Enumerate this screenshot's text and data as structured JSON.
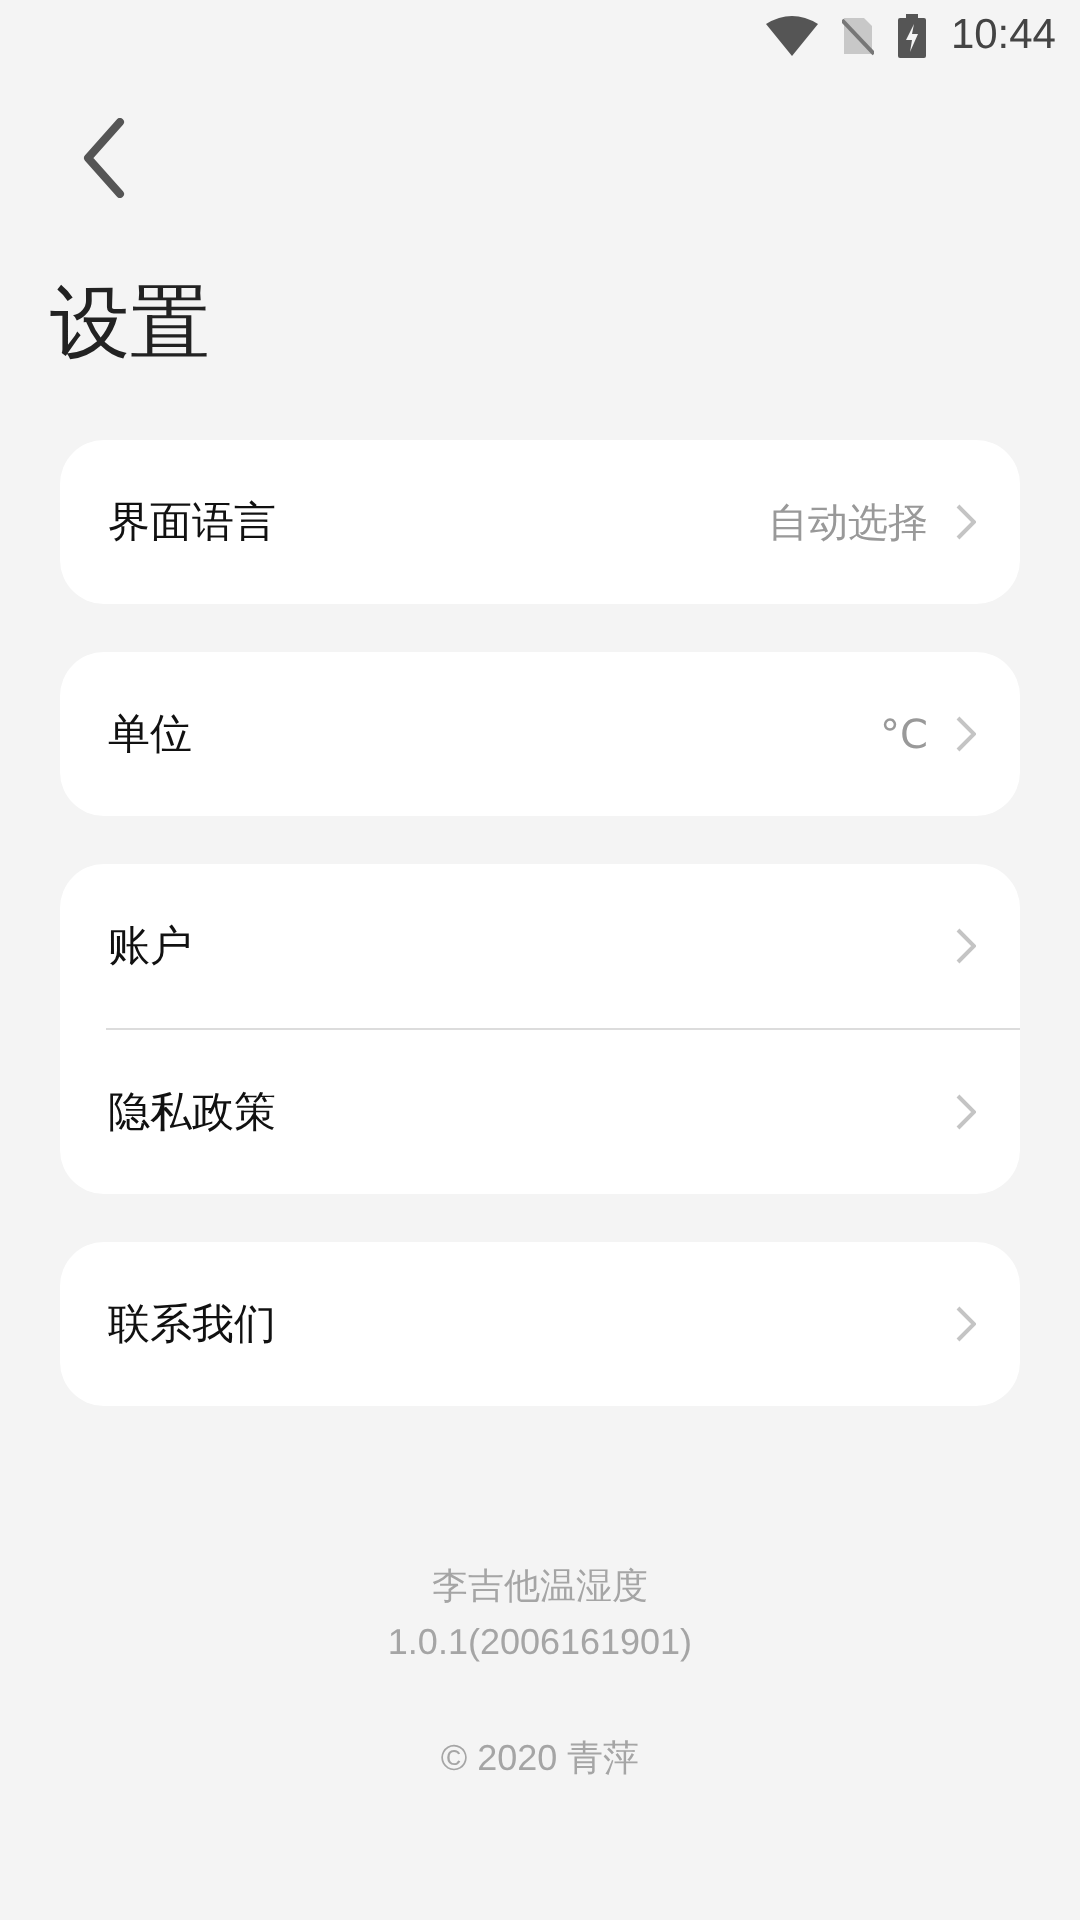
{
  "status_bar": {
    "time": "10:44"
  },
  "title": "设置",
  "groups": [
    {
      "items": [
        {
          "label": "界面语言",
          "value": "自动选择"
        }
      ]
    },
    {
      "items": [
        {
          "label": "单位",
          "value": "°C"
        }
      ]
    },
    {
      "items": [
        {
          "label": "账户"
        },
        {
          "label": "隐私政策"
        }
      ]
    },
    {
      "items": [
        {
          "label": "联系我们"
        }
      ]
    }
  ],
  "footer": {
    "app_name": "李吉他温湿度",
    "version": "1.0.1(2006161901)",
    "copyright": "© 2020 青萍"
  }
}
